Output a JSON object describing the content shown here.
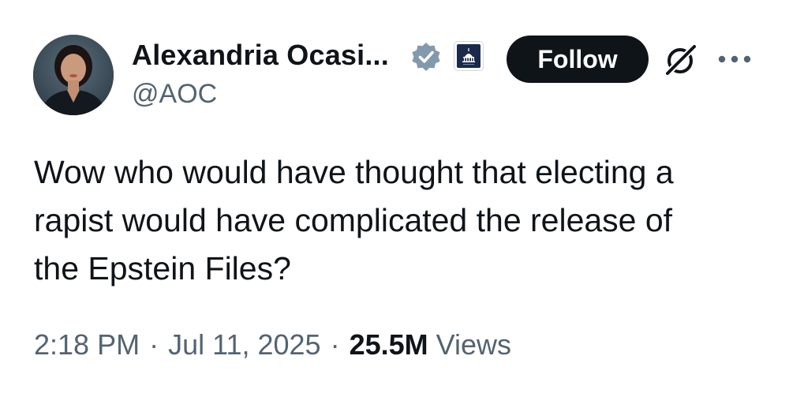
{
  "author": {
    "display_name": "Alexandria Ocasi...",
    "handle": "@AOC",
    "verified_icon": "verified-badge-icon",
    "affiliate_icon": "capitol-building-icon"
  },
  "actions": {
    "follow_label": "Follow",
    "grok_icon": "grok-icon",
    "more_icon": "more-icon"
  },
  "tweet": {
    "text": "Wow who would have thought that electing a\nrapist would have complicated the release of\nthe Epstein Files?"
  },
  "meta": {
    "time": "2:18 PM",
    "separator": "·",
    "date": "Jul 11, 2025",
    "views_count": "25.5M",
    "views_label": "Views"
  },
  "colors": {
    "text_primary": "#0f1419",
    "text_secondary": "#536471",
    "follow_bg": "#0f1419",
    "verified_gray": "#829aab"
  }
}
